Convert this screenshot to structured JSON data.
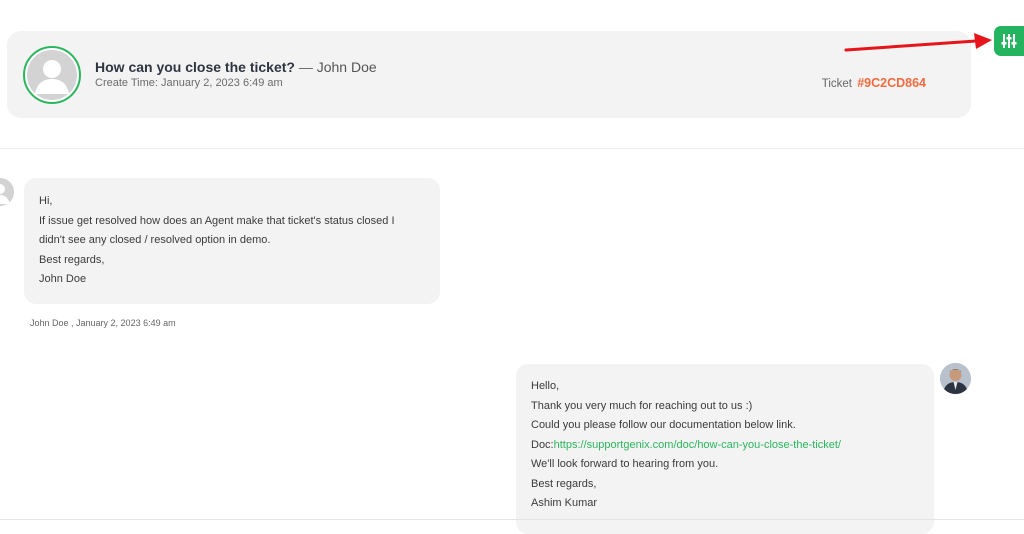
{
  "ticket": {
    "title": "How can you close the ticket?",
    "separator": "—",
    "author": "John Doe",
    "create_time": "Create Time: January 2, 2023 6:49 am",
    "id_label": "Ticket",
    "id_code": "#9C2CD864"
  },
  "icons": {
    "filter_button": "sliders-icon",
    "annotation": "red-arrow-icon",
    "customer_avatar": "default-user-avatar",
    "agent_avatar": "agent-photo-avatar"
  },
  "colors": {
    "accent_green": "#24b35f",
    "ticket_code": "#f26a3d",
    "bubble_bg": "#f3f3f3",
    "arrow_red": "#e8141b"
  },
  "messages": [
    {
      "side": "left",
      "lines": [
        "Hi,",
        "If issue get resolved how does an Agent make that ticket's status closed I",
        "didn't see any closed / resolved option in demo.",
        "Best regards,",
        "John Doe"
      ],
      "meta": "John Doe , January 2, 2023 6:49 am"
    },
    {
      "side": "right",
      "lines": [
        "Hello,",
        "Thank you very much for reaching out to us :)",
        "Could you please follow our documentation below link."
      ],
      "doc_prefix": "Doc:",
      "doc_link": "https://supportgenix.com/doc/how-can-you-close-the-ticket/",
      "lines_after": [
        "We'll look forward to hearing from you.",
        "Best regards,",
        "Ashim Kumar"
      ]
    }
  ]
}
